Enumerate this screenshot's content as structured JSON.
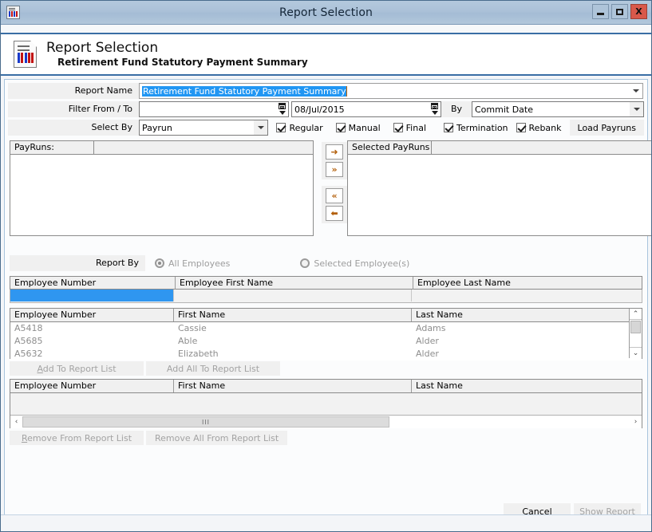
{
  "window": {
    "title": "Report Selection",
    "icon": "report-chart-icon",
    "minimize_label": "Minimize",
    "maximize_label": "Maximize",
    "close_label": "X"
  },
  "banner": {
    "icon": "report-chart-icon",
    "title": "Report Selection",
    "subtitle": "Retirement Fund Statutory Payment Summary"
  },
  "form": {
    "report_name_label": "Report Name",
    "report_name_value": "Retirement Fund Statutory Payment Summary",
    "filter_label": "Filter From / To",
    "filter_from_value": "",
    "filter_to_value": "08/Jul/2015",
    "by_label": "By",
    "by_value": "Commit Date",
    "select_by_label": "Select By",
    "select_by_value": "Payrun",
    "checkboxes": [
      {
        "label": "Regular",
        "checked": true
      },
      {
        "label": "Manual",
        "checked": true
      },
      {
        "label": "Final",
        "checked": true
      },
      {
        "label": "Termination",
        "checked": true
      },
      {
        "label": "Rebank",
        "checked": true
      }
    ],
    "load_payruns_label": "Load Payruns"
  },
  "payruns": {
    "left_header": "PayRuns:",
    "right_header": "Selected PayRuns",
    "left_rows": [],
    "right_rows": [],
    "transfer_buttons": [
      {
        "name": "move-right-button",
        "glyph": "➜"
      },
      {
        "name": "move-all-right-button",
        "glyph": "»"
      },
      {
        "name": "move-all-left-button",
        "glyph": "«"
      },
      {
        "name": "move-left-button",
        "glyph": "⬅"
      }
    ]
  },
  "report_by": {
    "label": "Report By",
    "options": [
      {
        "label": "All Employees",
        "selected": true
      },
      {
        "label": "Selected Employee(s)",
        "selected": false
      }
    ]
  },
  "search_grid": {
    "columns": [
      "Employee Number",
      "Employee First Name",
      "Employee Last Name"
    ],
    "filter_values": [
      "",
      "",
      ""
    ],
    "active_filter_index": 0
  },
  "available_grid": {
    "columns": [
      "Employee Number",
      "First Name",
      "Last Name"
    ],
    "rows": [
      [
        "A5418",
        "Cassie",
        "Adams"
      ],
      [
        "A5685",
        "Able",
        "Alder"
      ],
      [
        "A5632",
        "Elizabeth",
        "Alder"
      ]
    ],
    "scroll_up_glyph": "⌃",
    "scroll_down_glyph": "⌄"
  },
  "add_buttons": {
    "add_label": "Add To Report List",
    "add_accel": "A",
    "add_all_label": "Add All To Report List"
  },
  "report_grid": {
    "columns": [
      "Employee Number",
      "First Name",
      "Last Name"
    ],
    "rows": [],
    "scroll_left_glyph": "‹",
    "scroll_right_glyph": "›",
    "thumb_grip": "III"
  },
  "remove_buttons": {
    "remove_label": "Remove From Report List",
    "remove_accel": "R",
    "remove_all_label": "Remove All From Report List"
  },
  "footer": {
    "cancel_label": "Cancel",
    "cancel_accel": "C",
    "show_report_label": "Show Report",
    "show_report_accel": "o"
  },
  "colors": {
    "titlebar": "#abc1d8",
    "accent_border": "#3a6ea5",
    "selection_blue": "#2196f3",
    "close_red": "#d9594b",
    "arrow_orange": "#b35f0a",
    "disabled_text": "#a3a3a3"
  }
}
